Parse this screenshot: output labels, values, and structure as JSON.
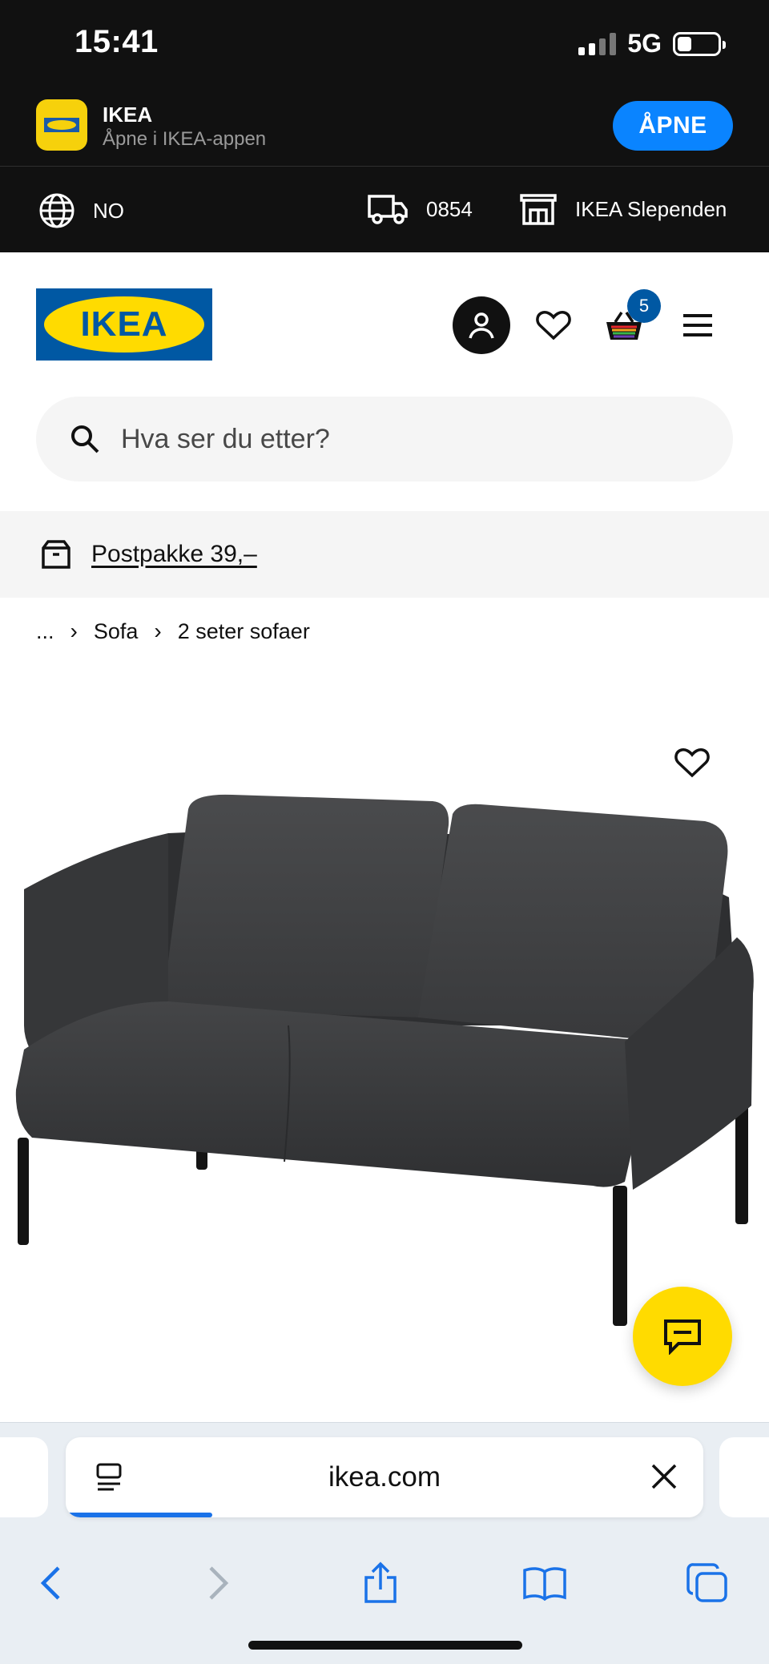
{
  "status_bar": {
    "time": "15:41",
    "network": "5G",
    "battery_level": 0.35
  },
  "app_banner": {
    "app_name": "IKEA",
    "subtitle": "Åpne i IKEA-appen",
    "open_label": "ÅPNE",
    "icon": "ikea-app-icon"
  },
  "region_bar": {
    "country": "NO",
    "postcode": "0854",
    "store": "IKEA Slependen"
  },
  "header": {
    "logo_text": "IKEA",
    "cart_count": "5",
    "icons": [
      "account-icon",
      "heart-icon",
      "cart-icon",
      "menu-icon"
    ],
    "colors": {
      "brand_blue": "#0058a3",
      "brand_yellow": "#ffdb00"
    }
  },
  "search": {
    "placeholder": "Hva ser du etter?"
  },
  "promo": {
    "text": "Postpakke 39,–"
  },
  "breadcrumb": {
    "ellipsis": "...",
    "items": [
      "Sofa",
      "2 seter sofaer"
    ]
  },
  "product": {
    "image": "gray two-seat sofa with black legs"
  },
  "browser": {
    "url": "ikea.com",
    "load_progress": 0.23
  }
}
